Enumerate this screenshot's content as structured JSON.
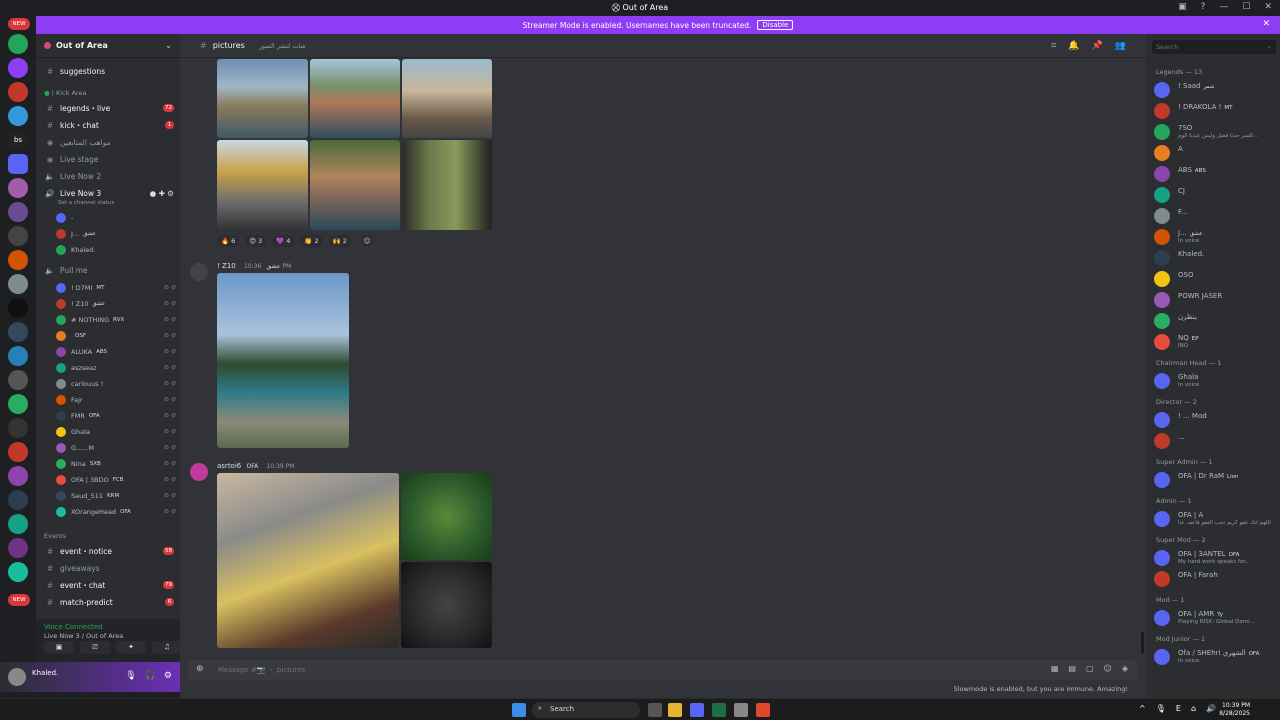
{
  "window": {
    "title": "Out of Area"
  },
  "banner": {
    "text": "Streamer Mode is enabled. Usernames have been truncated.",
    "disable_label": "Disable"
  },
  "server": {
    "name": "Out of Area"
  },
  "server_badges": {
    "new_top": "NEW",
    "new_bottom": "NEW",
    "bs": "bs"
  },
  "channels": {
    "suggestions": "suggestions",
    "kick_area": "| Kick Area",
    "legends_live": "legends・live",
    "legends_live_badge": "72",
    "kick_chat": "kick・chat",
    "kick_chat_badge": "1",
    "stage_ar": "مواهب المتابعين",
    "live_stage": "Live stage",
    "live_now_1": "Live Now 2",
    "live_now_2": "Live Now 3",
    "channel_status": "Set a channel status",
    "pull_me": "Pull me",
    "events_cat": "Events",
    "event_notice": "event・notice",
    "event_notice_badge": "58",
    "giveaways": "giveaways",
    "event_chat": "event・chat",
    "event_chat_badge": "79",
    "match_predict": "match-predict",
    "match_predict_badge": "6"
  },
  "voice_users_live": [
    {
      "name": "-"
    },
    {
      "name": "J...",
      "tag": "عشق"
    },
    {
      "name": "Khaled."
    }
  ],
  "voice_users_pull": [
    {
      "name": "! D7MI",
      "tag": "MT"
    },
    {
      "name": "! Z10",
      "tag": "عشق"
    },
    {
      "name": "# NOTHING",
      "tag": "RVX"
    },
    {
      "name": "",
      "tag": "OSF"
    },
    {
      "name": "ALUKA",
      "tag": "ABS"
    },
    {
      "name": "aszseaz",
      "tag": ""
    },
    {
      "name": "carlouus !",
      "tag": ""
    },
    {
      "name": "Fajr",
      "tag": ""
    },
    {
      "name": "FMR",
      "tag": "OFA"
    },
    {
      "name": "Ghala",
      "tag": ""
    },
    {
      "name": "G......M",
      "tag": ""
    },
    {
      "name": "Nina",
      "tag": "SXB"
    },
    {
      "name": "OFA | 3BDO",
      "tag": "FCB"
    },
    {
      "name": "Saud_511",
      "tag": "KRM"
    },
    {
      "name": "XOrangeHead",
      "tag": "OFA"
    }
  ],
  "voice_panel": {
    "status": "Voice Connected",
    "sub": "Live Now 3 / Out of Area"
  },
  "user_panel": {
    "name": "Khaled."
  },
  "main": {
    "channel": "pictures",
    "channel_sub": "شات لنشر الصور",
    "msg1": {
      "author": "! Z10",
      "tag": "عشق",
      "time": "10:36 PM"
    },
    "msg2": {
      "author": "asrtoi6",
      "tag": "OFA",
      "time": "10:39 PM"
    },
    "reactions": [
      {
        "emoji": "🔥",
        "count": "6"
      },
      {
        "emoji": "😍",
        "count": "3"
      },
      {
        "emoji": "💜",
        "count": "4"
      },
      {
        "emoji": "👏",
        "count": "2"
      },
      {
        "emoji": "🙌",
        "count": "2"
      }
    ]
  },
  "composer": {
    "placeholder": "Message #📷 ・ pictures"
  },
  "slowmode": {
    "text": "Slowmode is enabled, but you are immune. Amazing!"
  },
  "members": {
    "search_placeholder": "Search",
    "groups": {
      "legends": "Legends — 13",
      "chairman": "Chairman Head — 1",
      "director": "Director — 2",
      "super_admin": "Super Admin — 1",
      "admin": "Admin — 1",
      "super_mod": "Super Mod — 2",
      "mod": "Mod — 1",
      "mod_junior": "Mod Junior — 1"
    },
    "legends_list": [
      {
        "name": "! Saad",
        "tag": "شمر",
        "status": ""
      },
      {
        "name": "! DRAKOLA !",
        "tag": "MT",
        "status": ""
      },
      {
        "name": "7SO",
        "tag": "",
        "status": "للسر حدنا فضل وليس عندنا الوم..."
      },
      {
        "name": "A",
        "tag": "",
        "status": ""
      },
      {
        "name": "ABS",
        "tag": "ABS",
        "status": ""
      },
      {
        "name": "CJ",
        "tag": "",
        "status": ""
      },
      {
        "name": "F...",
        "tag": "",
        "status": ""
      },
      {
        "name": "J...",
        "tag": "عشق",
        "status": "In voice"
      },
      {
        "name": "Khaled.",
        "tag": "",
        "status": ""
      },
      {
        "name": "OSO",
        "tag": "",
        "status": ""
      },
      {
        "name": "POWR JASER",
        "tag": "",
        "status": ""
      },
      {
        "name": "ينظرن",
        "tag": "",
        "status": ""
      },
      {
        "name": "NQ",
        "tag": "EP",
        "status": "INQ"
      }
    ],
    "chairman_list": [
      {
        "name": "Ghala",
        "status": "In voice"
      }
    ],
    "director_list": [
      {
        "name": "! ... Mod"
      },
      {
        "name": "..."
      }
    ],
    "super_admin_list": [
      {
        "name": "OFA | Dr RaM",
        "tag": "Lion"
      }
    ],
    "admin_list": [
      {
        "name": "OFA | A",
        "status": "اللهم انك عفو كريم تحب العفو فاعف عنا"
      }
    ],
    "super_mod_list": [
      {
        "name": "OFA | 3ANTEL",
        "tag": "OFA",
        "status": "My hard work speaks for..."
      },
      {
        "name": "OFA | Farah"
      }
    ],
    "mod_list": [
      {
        "name": "OFA | AMR",
        "tag": "Ty",
        "status": "Playing RISK: Global Domi..."
      }
    ],
    "mod_junior_list": [
      {
        "name": "Ofa / SHEhri الشهري",
        "tag": "OFA",
        "status": "In voice"
      }
    ]
  },
  "taskbar": {
    "search": "Search",
    "time": "10:39 PM",
    "date": "8/28/2025"
  },
  "colors": {
    "accent": "#8f3cf5",
    "badge": "#da373c",
    "online": "#23a55a"
  }
}
